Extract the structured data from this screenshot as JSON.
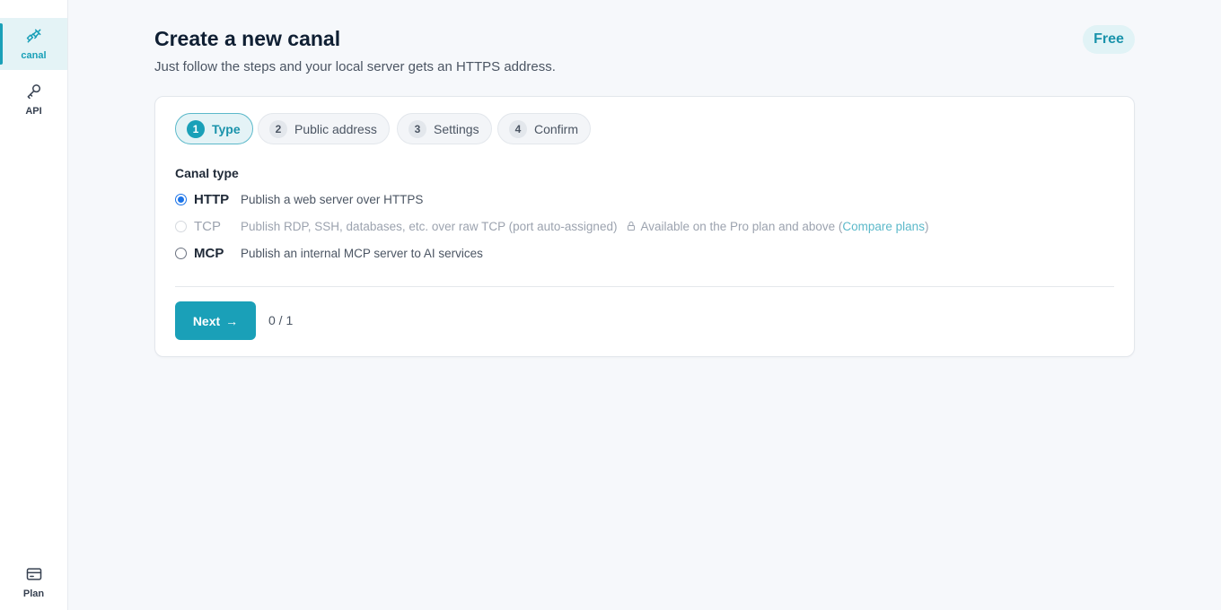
{
  "sidebar": {
    "items": [
      {
        "label": "canal",
        "icon": "plug-icon",
        "active": true
      },
      {
        "label": "API",
        "icon": "key-icon",
        "active": false
      }
    ],
    "bottom_item": {
      "label": "Plan",
      "icon": "credit-card-icon"
    }
  },
  "header": {
    "title": "Create a new canal",
    "subtitle": "Just follow the steps and your local server gets an HTTPS address.",
    "plan_badge": "Free"
  },
  "steps": [
    {
      "number": "1",
      "label": "Type",
      "active": true
    },
    {
      "number": "2",
      "label": "Public address",
      "active": false
    },
    {
      "number": "3",
      "label": "Settings",
      "active": false
    },
    {
      "number": "4",
      "label": "Confirm",
      "active": false
    }
  ],
  "form": {
    "section_label": "Canal type",
    "options": [
      {
        "name": "HTTP",
        "description": "Publish a web server over HTTPS",
        "checked": true,
        "disabled": false
      },
      {
        "name": "TCP",
        "description": "Publish RDP, SSH, databases, etc. over raw TCP (port auto-assigned)",
        "checked": false,
        "disabled": true,
        "note_prefix": "Available on the Pro plan and above (",
        "note_link": "Compare plans",
        "note_suffix": ")"
      },
      {
        "name": "MCP",
        "description": "Publish an internal MCP server to AI services",
        "checked": false,
        "disabled": false
      }
    ]
  },
  "footer": {
    "next_label": "Next",
    "next_arrow": "→",
    "counter": "0 / 1"
  },
  "colors": {
    "accent": "#1aa0b8",
    "radio_checked": "#1a73e8",
    "background": "#f6f8fb"
  }
}
